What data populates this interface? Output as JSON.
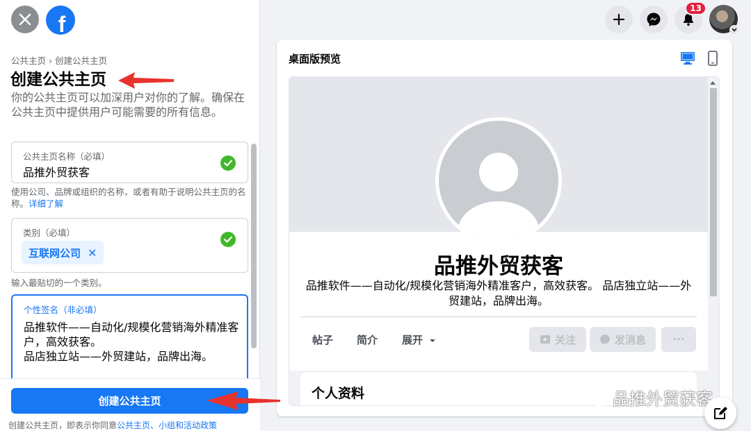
{
  "header": {
    "breadcrumb": "公共主页 › 创建公共主页",
    "title": "创建公共主页",
    "intro": "你的公共主页可以加深用户对你的了解。确保在公共主页中提供用户可能需要的所有信息。"
  },
  "form": {
    "name_field": {
      "label": "公共主页名称（必填）",
      "value": "品推外贸获客",
      "hint": "使用公司、品牌或组织的名称，或者有助于说明公共主页的名称。",
      "hint_link": "详细了解"
    },
    "category_field": {
      "label": "类别（必填）",
      "chip": "互联网公司",
      "hint": "输入最贴切的一个类别。"
    },
    "bio_field": {
      "label": "个性签名（非必填）",
      "value": "品推软件——自动化/规模化营销海外精准客户，高效获客。\n品店独立站——外贸建站，品牌出海。"
    }
  },
  "footer": {
    "create_button": "创建公共主页",
    "terms_prefix": "创建公共主页，即表示你同意",
    "terms_link": "公共主页、小组和活动政策"
  },
  "topnav": {
    "notification_count": "13"
  },
  "preview": {
    "title": "桌面版预览",
    "page_name": "品推外贸获客",
    "page_bio": "品推软件——自动化/规模化营销海外精准客户，高效获客。 品店独立站——外贸建站，品牌出海。",
    "tabs": [
      "帖子",
      "简介",
      "展开"
    ],
    "follow_button": "关注",
    "message_button": "发消息",
    "more_button": "···",
    "info_title": "个人资料"
  },
  "watermark": "品推外贸获客",
  "colors": {
    "brand": "#1877f2",
    "success": "#42b72a",
    "badge": "#e41e3f",
    "annotation": "#e8322d"
  }
}
